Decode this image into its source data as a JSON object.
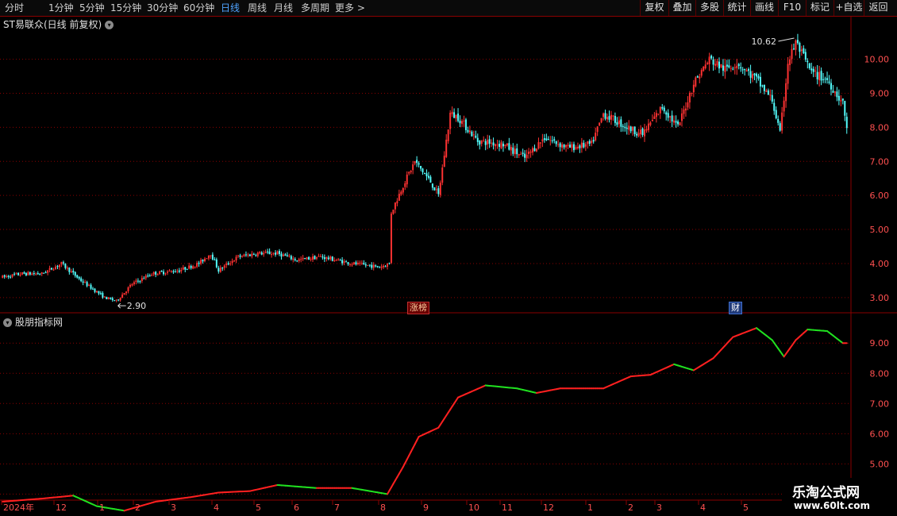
{
  "toolbar": {
    "periods": [
      "分时",
      "1分钟",
      "5分钟",
      "15分钟",
      "30分钟",
      "60分钟",
      "日线",
      "周线",
      "月线",
      "多周期",
      "更多 >"
    ],
    "active_period": "日线",
    "right_buttons": [
      "复权",
      "叠加",
      "多股",
      "统计",
      "画线",
      "F10",
      "标记",
      "+自选",
      "返回"
    ]
  },
  "main_title": "ST易联众(日线 前复权)",
  "sub_title": "股朋指标网",
  "annotations": {
    "high_label": "10.62",
    "low_label": "2.90",
    "badge_up": "涨榜",
    "badge_fin": "财"
  },
  "watermark": {
    "line1": "乐淘公式网",
    "line2": "www.60lt.com"
  },
  "colors": {
    "up": "#ff3232",
    "down": "#54ffff",
    "line_up": "#ff2020",
    "line_down": "#20e020",
    "grid": "#8a0000",
    "axis_text": "#ff5050"
  },
  "chart_data": [
    {
      "type": "candlestick",
      "title": "ST易联众(日线 前复权)",
      "y_ticks": [
        3.0,
        4.0,
        5.0,
        6.0,
        7.0,
        8.0,
        9.0,
        10.0
      ],
      "ylim": [
        2.6,
        10.9
      ],
      "x_ticks": [
        "2024年",
        "12",
        "1",
        "2",
        "3",
        "4",
        "5",
        "6",
        "7",
        "8",
        "9",
        "10",
        "11",
        "12",
        "1",
        "2",
        "3",
        "4",
        "5"
      ],
      "anchors": [
        [
          0,
          3.6
        ],
        [
          10,
          3.7
        ],
        [
          20,
          3.7
        ],
        [
          30,
          4.0
        ],
        [
          40,
          3.5
        ],
        [
          52,
          3.0
        ],
        [
          58,
          2.9
        ],
        [
          66,
          3.4
        ],
        [
          76,
          3.7
        ],
        [
          90,
          3.8
        ],
        [
          100,
          4.0
        ],
        [
          106,
          4.3
        ],
        [
          110,
          3.8
        ],
        [
          120,
          4.2
        ],
        [
          130,
          4.3
        ],
        [
          140,
          4.3
        ],
        [
          150,
          4.1
        ],
        [
          162,
          4.2
        ],
        [
          178,
          4.0
        ],
        [
          192,
          3.9
        ],
        [
          197,
          4.0
        ],
        [
          198,
          5.5
        ],
        [
          204,
          6.3
        ],
        [
          210,
          7.0
        ],
        [
          218,
          6.4
        ],
        [
          222,
          6.0
        ],
        [
          228,
          8.4
        ],
        [
          232,
          8.3
        ],
        [
          242,
          7.6
        ],
        [
          255,
          7.5
        ],
        [
          266,
          7.1
        ],
        [
          276,
          7.7
        ],
        [
          288,
          7.4
        ],
        [
          300,
          7.5
        ],
        [
          306,
          8.4
        ],
        [
          318,
          8.0
        ],
        [
          326,
          7.8
        ],
        [
          336,
          8.6
        ],
        [
          344,
          8.0
        ],
        [
          352,
          9.3
        ],
        [
          360,
          10.0
        ],
        [
          368,
          9.7
        ],
        [
          374,
          9.9
        ],
        [
          384,
          9.4
        ],
        [
          392,
          8.8
        ],
        [
          396,
          7.8
        ],
        [
          400,
          9.9
        ],
        [
          404,
          10.5
        ],
        [
          412,
          9.6
        ],
        [
          420,
          9.4
        ],
        [
          428,
          8.7
        ],
        [
          430,
          8.0
        ]
      ],
      "low": {
        "value": 2.9,
        "index": 58
      },
      "high": {
        "value": 10.62,
        "index": 404
      }
    },
    {
      "type": "line",
      "title": "股朋指标网",
      "y_ticks": [
        4.0,
        5.0,
        6.0,
        7.0,
        8.0,
        9.0
      ],
      "ylim": [
        3.8,
        9.9
      ],
      "anchors": [
        [
          0,
          3.75
        ],
        [
          20,
          3.85
        ],
        [
          36,
          3.95
        ],
        [
          48,
          3.6
        ],
        [
          62,
          3.45
        ],
        [
          78,
          3.75
        ],
        [
          96,
          3.9
        ],
        [
          110,
          4.05
        ],
        [
          126,
          4.1
        ],
        [
          140,
          4.3
        ],
        [
          160,
          4.2
        ],
        [
          178,
          4.2
        ],
        [
          196,
          4.0
        ],
        [
          204,
          4.9
        ],
        [
          212,
          5.9
        ],
        [
          222,
          6.2
        ],
        [
          232,
          7.2
        ],
        [
          246,
          7.6
        ],
        [
          262,
          7.5
        ],
        [
          272,
          7.35
        ],
        [
          284,
          7.5
        ],
        [
          306,
          7.5
        ],
        [
          320,
          7.9
        ],
        [
          330,
          7.95
        ],
        [
          342,
          8.3
        ],
        [
          352,
          8.1
        ],
        [
          362,
          8.5
        ],
        [
          372,
          9.2
        ],
        [
          384,
          9.5
        ],
        [
          392,
          9.1
        ],
        [
          398,
          8.55
        ],
        [
          404,
          9.1
        ],
        [
          410,
          9.45
        ],
        [
          420,
          9.4
        ],
        [
          428,
          9.0
        ]
      ]
    }
  ]
}
